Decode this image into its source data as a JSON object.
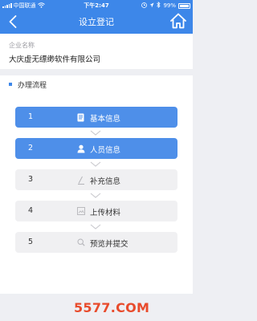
{
  "status_bar": {
    "carrier": "中国联通",
    "time": "下午2:47",
    "battery": "99%"
  },
  "nav": {
    "title": "设立登记"
  },
  "company": {
    "label": "企业名称",
    "value": "大庆虚无缥缈软件有限公司"
  },
  "process": {
    "title": "办理流程"
  },
  "steps": [
    {
      "num": "1",
      "label": "基本信息",
      "icon": "document-icon",
      "active": true
    },
    {
      "num": "2",
      "label": "人员信息",
      "icon": "person-icon",
      "active": true
    },
    {
      "num": "3",
      "label": "补充信息",
      "icon": "pencil-icon",
      "active": false
    },
    {
      "num": "4",
      "label": "上传材料",
      "icon": "image-icon",
      "active": false
    },
    {
      "num": "5",
      "label": "预览并提交",
      "icon": "search-icon",
      "active": false
    }
  ],
  "watermark": "5577.COM",
  "colors": {
    "primary": "#3d87e9",
    "active_step": "#4e8fe9",
    "inactive_step": "#f0f0f2",
    "watermark": "#e84b2c"
  }
}
